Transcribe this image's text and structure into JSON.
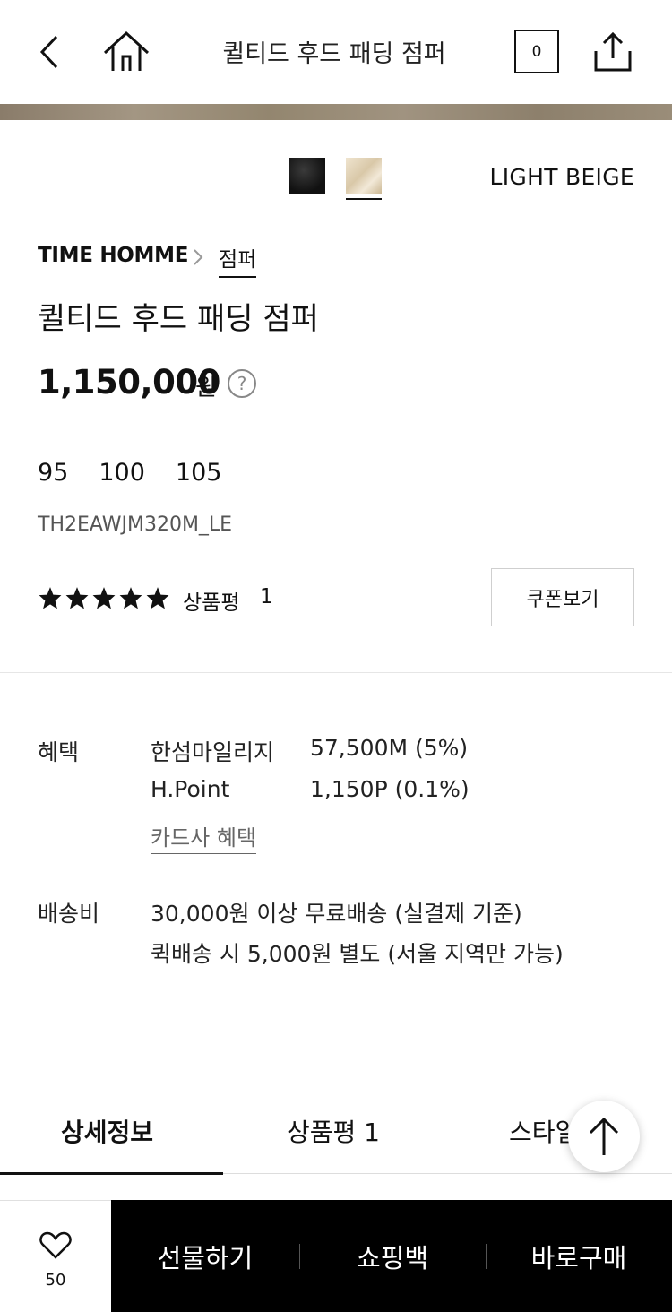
{
  "header": {
    "title": "퀼티드 후드 패딩 점퍼",
    "cart_count": "0"
  },
  "colors": {
    "selected_name": "LIGHT BEIGE",
    "options": [
      "black",
      "light-beige"
    ]
  },
  "product": {
    "brand": "TIME HOMME",
    "category": "점퍼",
    "name": "퀼티드 후드 패딩 점퍼",
    "price": "1,150,000",
    "price_unit": "원",
    "help_symbol": "?",
    "sizes": [
      "95",
      "100",
      "105"
    ],
    "sku": "TH2EAWJM320M_LE",
    "rating": 5,
    "review_label": "상품평",
    "review_count": "1",
    "coupon_label": "쿠폰보기"
  },
  "benefits": {
    "label": "혜택",
    "rows": [
      {
        "name": "한섬마일리지",
        "value": "57,500M (5%)"
      },
      {
        "name": "H.Point",
        "value": "1,150P (0.1%)"
      }
    ],
    "card_link": "카드사 혜택"
  },
  "shipping": {
    "label": "배송비",
    "line1": "30,000원 이상 무료배송 (실결제 기준)",
    "line2": "퀵배송 시 5,000원 별도 (서울 지역만 가능)"
  },
  "tabs": [
    "상세정보",
    "상품평 1",
    "스타일"
  ],
  "bottom_bar": {
    "wish_count": "50",
    "gift_label": "선물하기",
    "bag_label": "쇼핑백",
    "buy_label": "바로구매"
  },
  "theme": {
    "accent": "#111111",
    "action_bar_bg": "#000000"
  }
}
